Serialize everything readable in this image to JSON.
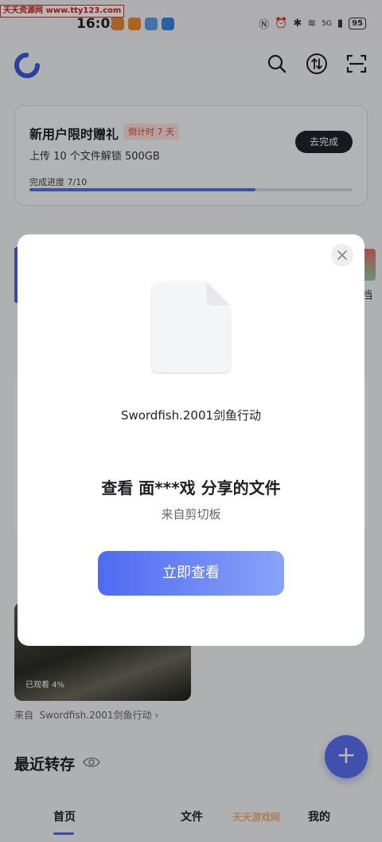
{
  "status_bar": {
    "watermark": "天天资源网 www.tty123.com",
    "time": "16:03",
    "battery": "95",
    "signal_text": "5G"
  },
  "header": {
    "logo_icon": "app-logo-icon",
    "icons": [
      "search-icon",
      "transfer-icon",
      "scan-icon"
    ]
  },
  "promo": {
    "title": "新用户限时赠礼",
    "countdown": "倒计时 7 天",
    "subtitle": "上传 10 个文件解锁 500GB",
    "button": "去完成",
    "progress_label": "完成进度 7/10",
    "progress_value": 0.7
  },
  "background": {
    "side_text": "档",
    "watched": "已观看 4%",
    "from_label": "来自",
    "from_file": "Swordfish.2001剑鱼行动",
    "recent_title": "最近转存"
  },
  "modal": {
    "file_name": "Swordfish.2001剑鱼行动",
    "share_title": "查看 面***戏 分享的文件",
    "share_source": "来自剪切板",
    "view_button": "立即查看"
  },
  "bottom_nav": {
    "items": [
      "首页",
      "文件",
      "我的"
    ],
    "active_index": 0,
    "watermark": "天天游戏网"
  },
  "colors": {
    "accent": "#5067e8",
    "dark_button": "#20232a"
  }
}
